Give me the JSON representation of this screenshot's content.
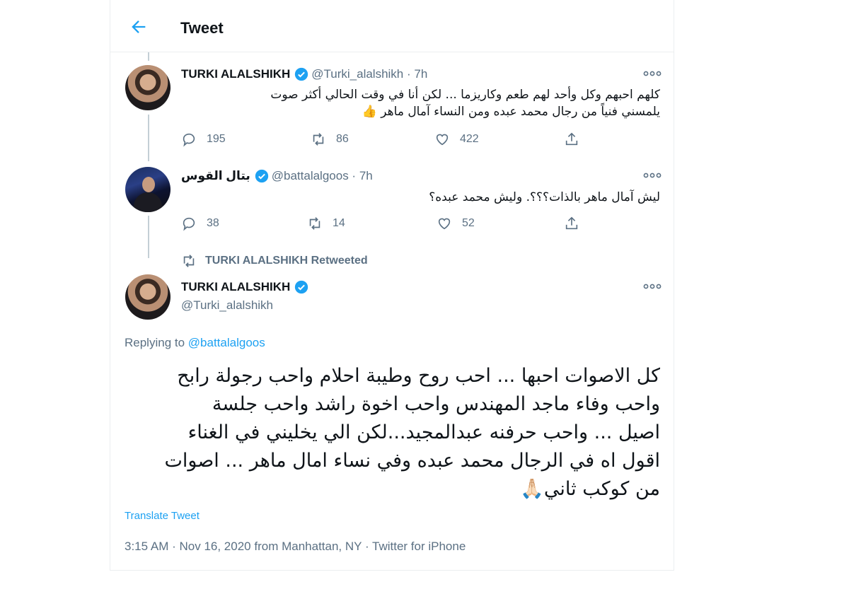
{
  "header": {
    "title": "Tweet"
  },
  "tweets": [
    {
      "name": "TURKI ALALSHIKH",
      "handle": "@Turki_alalshikh",
      "time": "7h",
      "text_line1": "كلهم احبهم وكل وأحد لهم طعم وكاريزما ... لكن أنا في وقت الحالي أكثر صوت",
      "text_line2": "يلمسني فنياً من رجال محمد عبده ومن النساء آمال ماهر 👍",
      "replies": "195",
      "retweets": "86",
      "likes": "422"
    },
    {
      "name": "بتال القوس",
      "handle": "@battalalgoos",
      "time": "7h",
      "text": "ليش آمال ماهر بالذات؟؟؟. وليش محمد عبده؟",
      "replies": "38",
      "retweets": "14",
      "likes": "52"
    }
  ],
  "retweeted_by": "TURKI ALALSHIKH Retweeted",
  "main_tweet": {
    "name": "TURKI ALALSHIKH",
    "handle": "@Turki_alalshikh",
    "replying_prefix": "Replying to",
    "replying_to": "@battalalgoos",
    "lines": [
      "كل الاصوات احبها ... احب روح وطيبة احلام واحب رجولة رابح",
      "واحب وفاء ماجد المهندس واحب اخوة راشد واحب جلسة",
      "اصيل ... واحب حرفنه عبدالمجيد...لكن الي يخليني في الغناء",
      "اقول اه في الرجال محمد عبده وفي نساء امال ماهر ... اصوات",
      "من كوكب ثاني🙏🏻"
    ],
    "translate": "Translate Tweet",
    "time": "3:15 AM",
    "date": "Nov 16, 2020",
    "location": "from Manhattan, NY",
    "client": "Twitter for iPhone"
  },
  "colors": {
    "accent": "#1da1f2",
    "muted": "#5b7083",
    "verified": "#1da1f2"
  },
  "icons": [
    "back-arrow-icon",
    "verified-icon",
    "more-icon",
    "reply-icon",
    "retweet-icon",
    "like-icon",
    "share-icon"
  ]
}
